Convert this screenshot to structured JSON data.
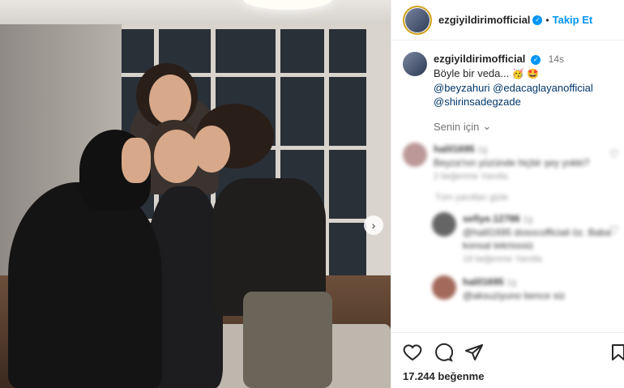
{
  "post": {
    "username": "ezgiyildirimofficial",
    "header_dot": "•",
    "follow_label": "Takip Et",
    "caption_text": "Böyle bir veda...",
    "caption_emojis": "🥳 🤩",
    "time_ago": "14s",
    "mentions": [
      "@beyzahuri @edacaglayanofficial",
      "@shirinsadegzade"
    ],
    "for_you_label": "Senin için",
    "likes_count": "17.244 beğenme"
  },
  "comments": [
    {
      "user": "halil1695",
      "time": "1g",
      "text": "Beyza'nın yüzünde hiçbir şey yokki?",
      "meta": "2 beğenme   Yanıtla"
    },
    {
      "hidden_label": "Tüm yanıtları gizle"
    },
    {
      "user": "sefiye.12786",
      "time": "1g",
      "text": "@halil1695 dosocofficiali öz. Baba konsal tekrisssiz",
      "meta": "18 beğenme   Yanıtla"
    },
    {
      "user": "halil1695",
      "time": "1g",
      "text": "@aksuziyuno bence siz"
    }
  ],
  "icons": {
    "like": "heart-icon",
    "comment": "comment-icon",
    "share": "send-icon",
    "save": "bookmark-icon",
    "verified": "verified-badge-icon",
    "next": "chevron-right-icon"
  },
  "colors": {
    "accent": "#0095f6",
    "text": "#262626",
    "muted": "#737373"
  }
}
